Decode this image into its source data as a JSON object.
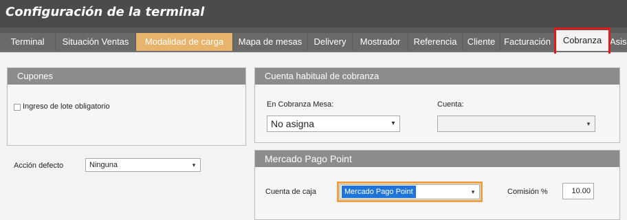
{
  "window": {
    "title": "Configuración de la terminal"
  },
  "tabs": [
    {
      "label": "Terminal"
    },
    {
      "label": "Situación Ventas"
    },
    {
      "label": "Modalidad de carga"
    },
    {
      "label": "Mapa de mesas"
    },
    {
      "label": "Delivery"
    },
    {
      "label": "Mostrador"
    },
    {
      "label": "Referencia"
    },
    {
      "label": "Cliente"
    },
    {
      "label": "Facturación"
    },
    {
      "label": "Cobranza"
    },
    {
      "label": "Asis"
    }
  ],
  "selected_tab": "Cobranza",
  "cupones": {
    "title": "Cupones",
    "checkbox_label": "Ingreso de lote obligatorio",
    "checked": false
  },
  "accion_defecto": {
    "label": "Acción defecto",
    "value": "Ninguna"
  },
  "cuenta_habitual": {
    "title": "Cuenta habitual de cobranza",
    "mesa_label": "En Cobranza Mesa:",
    "mesa_value": "No asigna",
    "cuenta_label": "Cuenta:",
    "cuenta_value": ""
  },
  "mercado_pago": {
    "title": "Mercado Pago Point",
    "cuenta_caja_label": "Cuenta de caja",
    "cuenta_caja_value": "Mercado Pago Point",
    "comision_label": "Comisión %",
    "comision_value": "10.00"
  },
  "colors": {
    "title_bar": "#4b4b4b",
    "panel_header": "#8c8c8c",
    "selection_blue": "#1e74d8",
    "highlight_red": "#e01a1a",
    "highlight_orange": "#f0a040",
    "active_tab_orange": "#e8b36a"
  },
  "icons": {
    "dropdown": "chevron-down-icon"
  }
}
